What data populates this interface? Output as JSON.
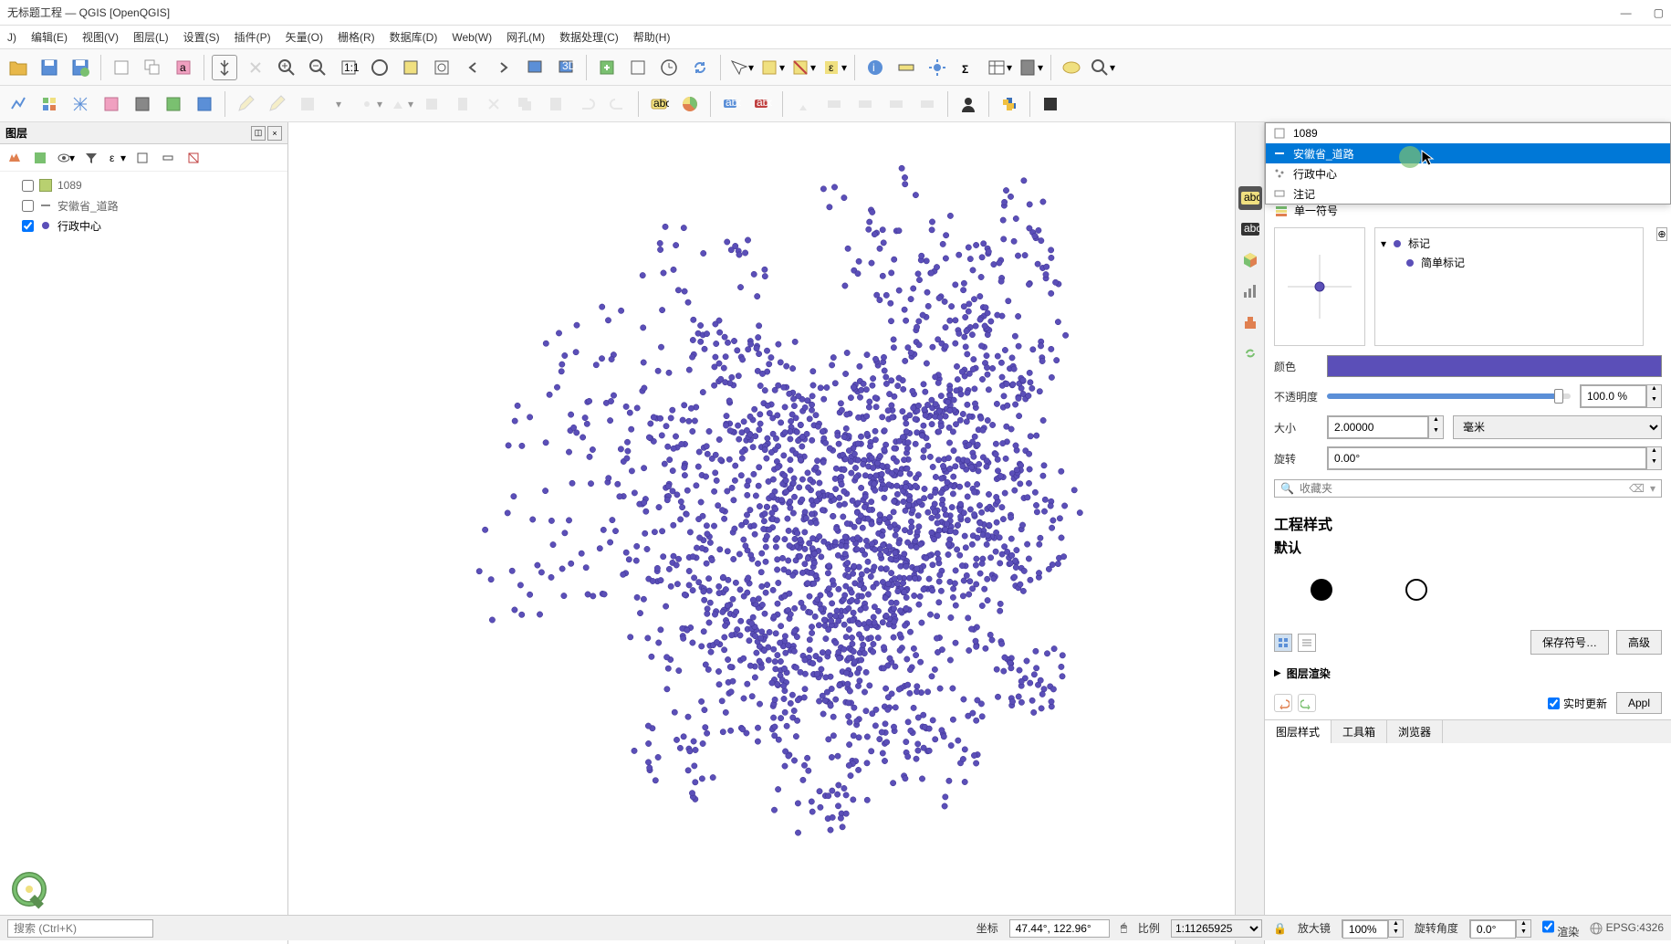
{
  "window": {
    "title": "无标题工程 — QGIS [OpenQGIS]"
  },
  "menu": {
    "items": [
      "J)",
      "编辑(E)",
      "视图(V)",
      "图层(L)",
      "设置(S)",
      "插件(P)",
      "矢量(O)",
      "栅格(R)",
      "数据库(D)",
      "Web(W)",
      "网孔(M)",
      "数据处理(C)",
      "帮助(H)"
    ]
  },
  "layers_panel": {
    "title": "图层",
    "items": [
      {
        "name": "1089",
        "checked": false,
        "swatch": "#b8d070",
        "type": "polygon"
      },
      {
        "name": "安徽省_道路",
        "checked": false,
        "swatch": "line",
        "type": "line"
      },
      {
        "name": "行政中心",
        "checked": true,
        "swatch": "#5b4fb8",
        "type": "point"
      }
    ]
  },
  "layer_dropdown": {
    "items": [
      {
        "label": "1089",
        "icon": "polygon"
      },
      {
        "label": "安徽省_道路",
        "icon": "line",
        "selected": true
      },
      {
        "label": "行政中心",
        "icon": "point"
      },
      {
        "label": "注记",
        "icon": "annotation"
      }
    ]
  },
  "style_panel": {
    "symbol_type": "单一符号",
    "marker_label": "标记",
    "simple_marker_label": "简单标记",
    "color_label": "颜色",
    "color_value": "#5b4fb8",
    "opacity_label": "不透明度",
    "opacity_value": "100.0 %",
    "size_label": "大小",
    "size_value": "2.00000",
    "size_unit": "毫米",
    "rotation_label": "旋转",
    "rotation_value": "0.00°",
    "search_placeholder": "收藏夹",
    "project_style_label": "工程样式",
    "default_label": "默认",
    "save_symbol": "保存符号…",
    "advanced": "高级",
    "layer_render": "图层渲染",
    "live_update": "实时更新",
    "apply": "Appl"
  },
  "right_tabs": {
    "items": [
      "图层样式",
      "工具箱",
      "浏览器"
    ],
    "active": 0
  },
  "statusbar": {
    "search_placeholder": "搜索 (Ctrl+K)",
    "coord_label": "坐标",
    "coord_value": "47.44°, 122.96°",
    "scale_label": "比例",
    "scale_value": "1:11265925",
    "magnifier_label": "放大镜",
    "magnifier_value": "100%",
    "rotation_label": "旋转角度",
    "rotation_value": "0.0°",
    "render_label": "渲染",
    "epsg": "EPSG:4326"
  }
}
